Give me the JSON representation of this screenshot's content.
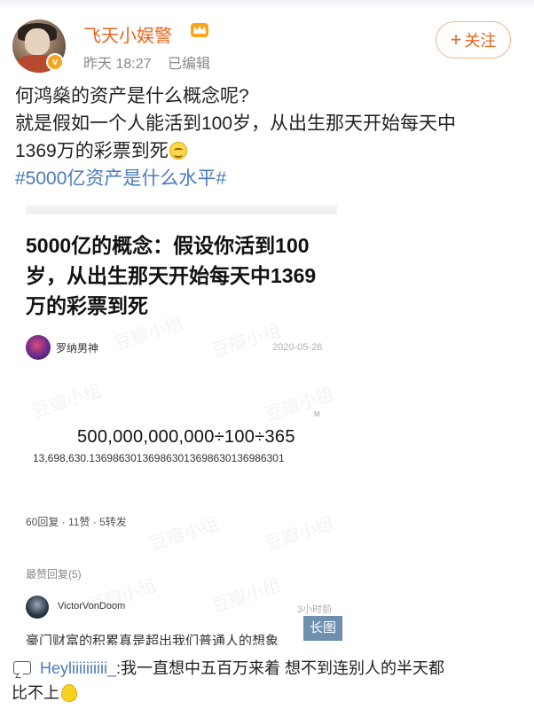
{
  "header": {
    "username": "飞天小娱警",
    "time": "昨天 18:27",
    "edited": "已编辑",
    "follow_label": "关注",
    "verified_badge": "v",
    "crown_icon": "crown-icon",
    "brand_color": "#e7631c"
  },
  "post": {
    "line1": "何鸿燊的资产是什么概念呢?",
    "line2": "就是假如一个人能活到100岁，从出生那天开始每天中",
    "line3": "1369万的彩票到死",
    "hashtag": "#5000亿资产是什么水平#",
    "hashtag_color": "#4a7bbd"
  },
  "long_image": {
    "title_line1": "5000亿的概念：假设你活到100",
    "title_line2": "岁，从出生那天开始每天中1369",
    "title_line3": "万的彩票到死",
    "author": "罗纳男神",
    "date": "2020-05-26",
    "m_mark": "M",
    "formula": "500,000,000,000÷100÷365",
    "result": "13,698,630.136986301369863013698630136986301",
    "stats": "60回复 · 11赞 · 5转发",
    "hot_replies": "最赞回复(5)",
    "replier": "VictorVonDoom",
    "reply_time": "3小时前",
    "reply_text": "豪门财富的积累真是超出我们普通人的想象",
    "long_tag": "长图",
    "watermark": "豆瓣小组"
  },
  "comment": {
    "author": "Heyliiiiiiiiii_",
    "text_line1": ":我一直想中五百万来着 想不到连别人的半天都",
    "text_line2": "比不上"
  }
}
